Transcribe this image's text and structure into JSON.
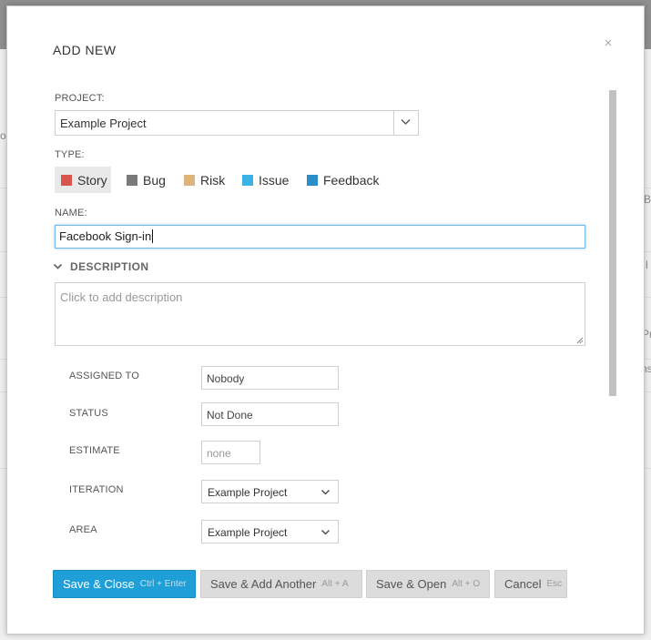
{
  "dialog": {
    "title": "ADD NEW",
    "close_symbol": "×"
  },
  "project": {
    "label": "PROJECT:",
    "value": "Example Project"
  },
  "type": {
    "label": "TYPE:",
    "selected": "Story",
    "options": [
      {
        "label": "Story",
        "color": "#d9534f"
      },
      {
        "label": "Bug",
        "color": "#7a7a7a"
      },
      {
        "label": "Risk",
        "color": "#deb47a"
      },
      {
        "label": "Issue",
        "color": "#3bb1e6"
      },
      {
        "label": "Feedback",
        "color": "#2a8ec8"
      }
    ]
  },
  "name": {
    "label": "NAME:",
    "value": "Facebook Sign-in"
  },
  "description": {
    "heading": "DESCRIPTION",
    "placeholder": "Click to add description"
  },
  "fields": {
    "assigned_to": {
      "label": "ASSIGNED TO",
      "value": "Nobody"
    },
    "status": {
      "label": "STATUS",
      "value": "Not Done"
    },
    "estimate": {
      "label": "ESTIMATE",
      "placeholder": "none"
    },
    "iteration": {
      "label": "ITERATION",
      "value": "Example Project"
    },
    "area": {
      "label": "AREA",
      "value": "Example Project"
    }
  },
  "buttons": {
    "save_close": {
      "label": "Save & Close",
      "shortcut": "Ctrl + Enter"
    },
    "save_add": {
      "label": "Save & Add Another",
      "shortcut": "Alt + A"
    },
    "save_open": {
      "label": "Save & Open",
      "shortcut": "Alt + O"
    },
    "cancel": {
      "label": "Cancel",
      "shortcut": "Esc"
    }
  },
  "background": {
    "fragments": [
      "o",
      "B",
      "l",
      "Pr",
      "ns"
    ]
  },
  "colors": {
    "primary": "#1e9fd8",
    "focus_border": "#7ab6e3"
  }
}
